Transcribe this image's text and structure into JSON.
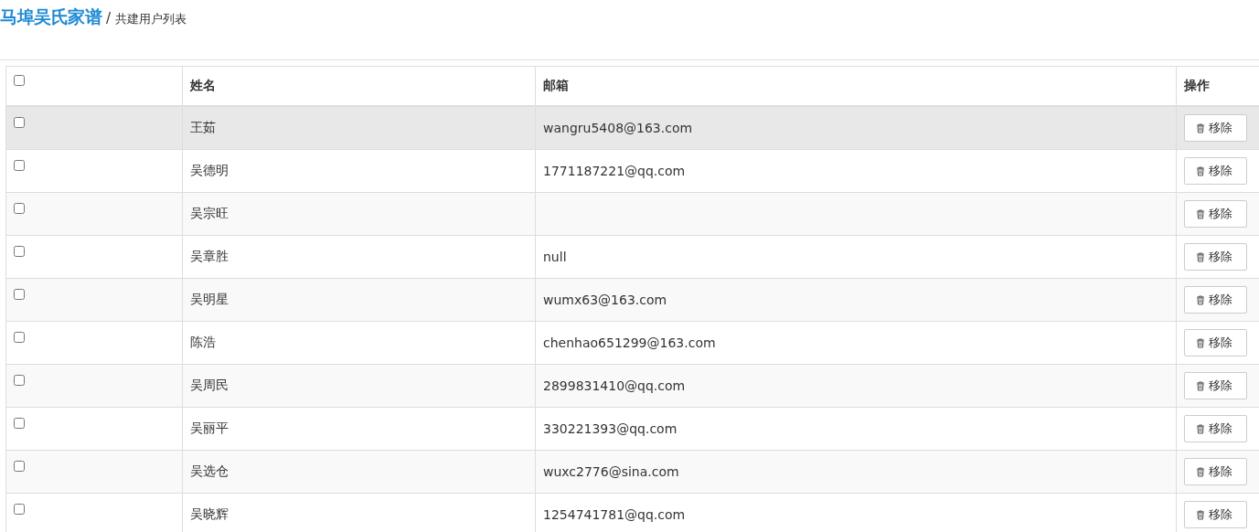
{
  "header": {
    "title": "马埠吴氏家谱",
    "separator": "/",
    "subtitle": "共建用户列表"
  },
  "table": {
    "select_all": {
      "checked": false
    },
    "columns": [
      "姓名",
      "邮箱",
      "操作"
    ],
    "rows": [
      {
        "checked": false,
        "highlighted": true,
        "name": "王茹",
        "email": "wangru5408@163.com",
        "action": "移除"
      },
      {
        "checked": false,
        "highlighted": false,
        "name": "吴德明",
        "email": "1771187221@qq.com",
        "action": "移除"
      },
      {
        "checked": false,
        "highlighted": false,
        "name": "吴宗旺",
        "action": "移除"
      },
      {
        "checked": false,
        "highlighted": false,
        "name": "吴章胜",
        "email": "null",
        "action": "移除"
      },
      {
        "checked": false,
        "highlighted": false,
        "name": "吴明星",
        "email": "wumx63@163.com",
        "action": "移除"
      },
      {
        "checked": false,
        "highlighted": false,
        "name": "陈浩",
        "email": "chenhao651299@163.com",
        "action": "移除"
      },
      {
        "checked": false,
        "highlighted": false,
        "name": "吴周民",
        "email": "2899831410@qq.com",
        "action": "移除"
      },
      {
        "checked": false,
        "highlighted": false,
        "name": "吴丽平",
        "email": "330221393@qq.com",
        "action": "移除"
      },
      {
        "checked": false,
        "highlighted": false,
        "name": "吴选仓",
        "email": "wuxc2776@sina.com",
        "action": "移除"
      },
      {
        "checked": false,
        "highlighted": false,
        "name": "吴晓辉",
        "email": "1254741781@qq.com",
        "action": "移除"
      }
    ]
  }
}
